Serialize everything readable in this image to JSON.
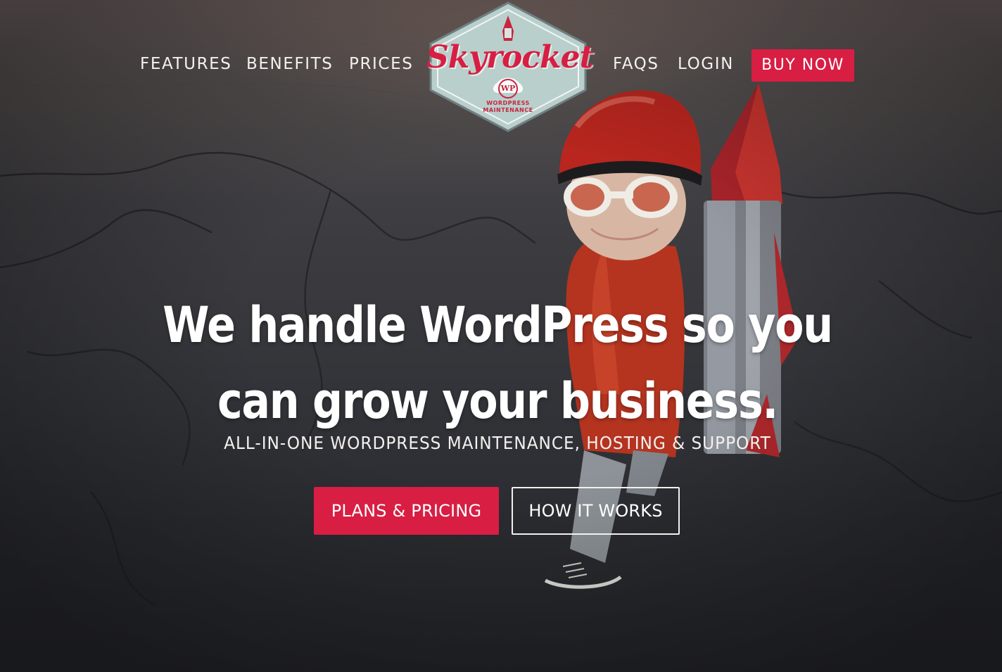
{
  "nav": {
    "left_items": [
      "FEATURES",
      "BENEFITS",
      "PRICES"
    ],
    "right_items": [
      "FAQS",
      "LOGIN"
    ],
    "buy_label": "BUY NOW"
  },
  "logo": {
    "name": "Skyrocket",
    "badge": "WP",
    "tagline_line1": "WORDPRESS",
    "tagline_line2": "MAINTENANCE"
  },
  "hero": {
    "headline_line1": "We handle WordPress so you",
    "headline_line2": "can grow your business.",
    "subheadline": "ALL-IN-ONE WORDPRESS MAINTENANCE, HOSTING & SUPPORT",
    "primary_cta": "PLANS & PRICING",
    "secondary_cta": "HOW IT WORKS"
  },
  "colors": {
    "accent": "#d81e43",
    "logo_bg": "#b9cfcc",
    "text": "#ffffff"
  }
}
